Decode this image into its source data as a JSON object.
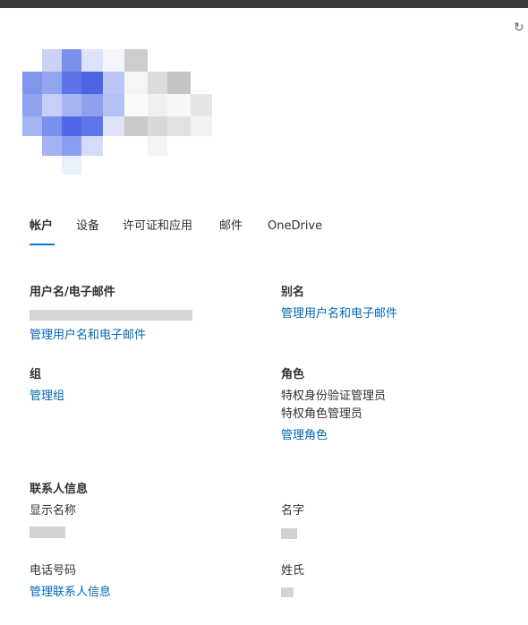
{
  "tabs": [
    "帐户",
    "设备",
    "许可证和应用",
    "邮件",
    "OneDrive"
  ],
  "sections": {
    "username": {
      "title": "用户名/电子邮件",
      "link": "管理用户名和电子邮件"
    },
    "alias": {
      "title": "别名",
      "link": "管理用户名和电子邮件"
    },
    "groups": {
      "title": "组",
      "link": "管理组"
    },
    "roles": {
      "title": "角色",
      "items": [
        "特权身份验证管理员",
        "特权角色管理员"
      ],
      "link": "管理角色"
    },
    "contact": {
      "title": "联系人信息",
      "display_name_label": "显示名称",
      "first_name_label": "名字",
      "phone_label": "电话号码",
      "phone_link": "管理联系人信息",
      "last_name_label": "姓氏"
    }
  },
  "icons": {
    "refresh": "refresh-icon"
  },
  "colors": {
    "link": "#0067b8",
    "tab_underline": "#0078d4",
    "top_bar": "#3b3a39"
  }
}
